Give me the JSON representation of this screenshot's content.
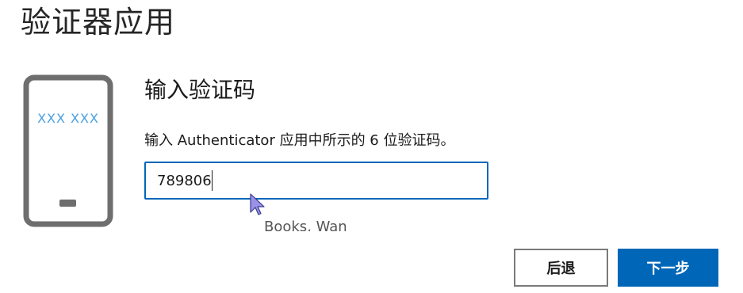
{
  "page": {
    "title": "验证器应用"
  },
  "phone": {
    "code_placeholder": "XXX XXX",
    "code_color": "#4a9fe0",
    "frame_color": "#6e6e6e"
  },
  "main": {
    "heading": "输入验证码",
    "instruction": "输入 Authenticator 应用中所示的 6 位验证码。",
    "code_input": {
      "value": "789806",
      "placeholder": ""
    },
    "clipped_text": "Books, Wan"
  },
  "actions": {
    "back_label": "后退",
    "next_label": "下一步"
  },
  "colors": {
    "accent": "#0067b8",
    "text": "#1b1b1b",
    "secondary_border": "#7a7a7a"
  }
}
